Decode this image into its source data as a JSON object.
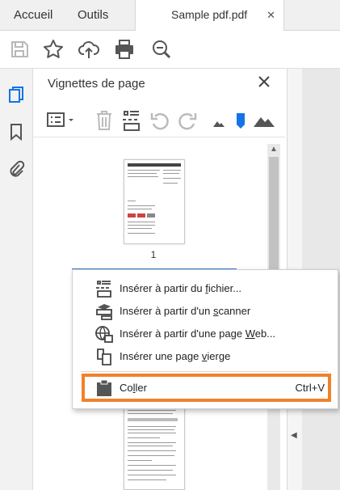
{
  "tabs": {
    "home_label": "Accueil",
    "tools_label": "Outils",
    "document_label": "Sample pdf.pdf",
    "close_glyph": "✕"
  },
  "panel": {
    "title": "Vignettes de page",
    "page_number": "1"
  },
  "context_menu": {
    "items": [
      {
        "prefix": "Insérer à partir du ",
        "mnemonic": "f",
        "suffix": "ichier..."
      },
      {
        "prefix": "Insérer à partir d'un ",
        "mnemonic": "s",
        "suffix": "canner"
      },
      {
        "prefix": "Insérer à partir d'une page ",
        "mnemonic": "W",
        "suffix": "eb..."
      },
      {
        "prefix": "Insérer une page ",
        "mnemonic": "v",
        "suffix": "ierge"
      }
    ],
    "paste": {
      "prefix": "Co",
      "mnemonic": "l",
      "suffix": "ler",
      "shortcut": "Ctrl+V"
    }
  },
  "icons": {
    "toolbar": [
      "save-icon",
      "star-icon",
      "cloud-upload-icon",
      "print-icon",
      "zoom-out-icon"
    ],
    "rail": [
      "page-thumbnails-icon",
      "bookmark-icon",
      "attachment-icon"
    ],
    "panel_tools": [
      "options-menu-icon",
      "delete-icon",
      "insert-page-icon",
      "rotate-left-icon",
      "rotate-right-icon",
      "zoom-small-icon",
      "zoom-marker-icon",
      "zoom-large-icon"
    ]
  },
  "colors": {
    "accent_blue": "#1473e6",
    "highlight_orange": "#f0822b"
  }
}
